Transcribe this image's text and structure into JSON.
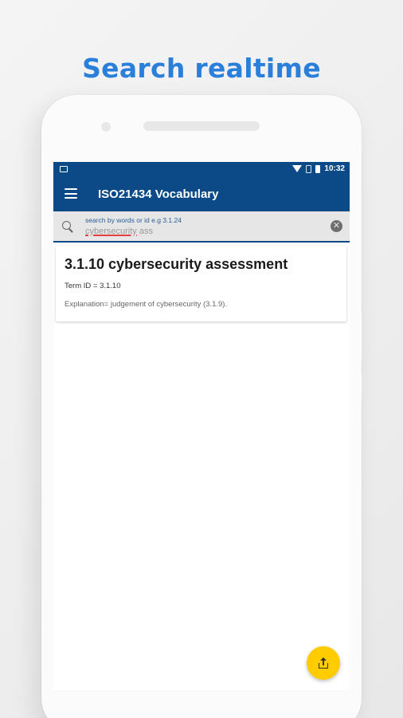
{
  "headline": "Search realtime",
  "status_bar": {
    "time": "10:32",
    "icons": [
      "screenshot-icon",
      "wifi-icon",
      "no-sim-icon",
      "battery-icon"
    ]
  },
  "toolbar": {
    "title": "ISO21434 Vocabulary",
    "menu_icon": "menu-icon"
  },
  "search": {
    "hint": "search by words or id e.g 3.1.24",
    "value_word1": "cybersecurity",
    "value_word2": "ass",
    "icon": "search-icon",
    "clear_icon": "clear-icon",
    "clear_glyph": "✕"
  },
  "results": [
    {
      "title": "3.1.10 cybersecurity assessment",
      "term_id": "Term ID = 3.1.10",
      "explanation": "Explanation= judgement of cybersecurity (3.1.9)."
    }
  ],
  "fab": {
    "icon": "share-icon"
  },
  "colors": {
    "primary": "#0b4a86",
    "headline": "#2a7fdb",
    "fab": "#ffcc00",
    "search_bg": "#e6e6e6"
  }
}
